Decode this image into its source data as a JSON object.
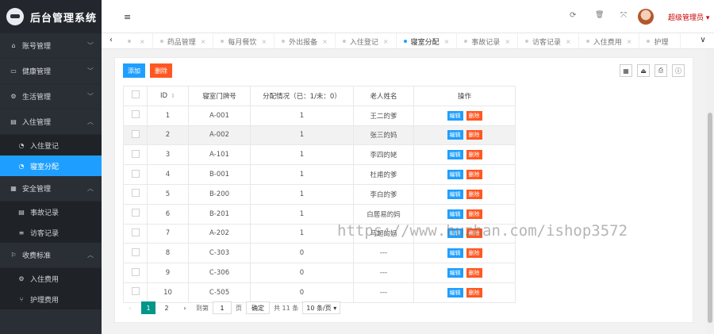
{
  "app": {
    "title": "后台管理系统"
  },
  "sidebar": {
    "items": [
      {
        "label": "账号管理",
        "icon": "home-icon",
        "glyph": "⌂",
        "caret": "﹀"
      },
      {
        "label": "健康管理",
        "icon": "monitor-icon",
        "glyph": "▭",
        "caret": "﹀"
      },
      {
        "label": "生活管理",
        "icon": "cogs-icon",
        "glyph": "⚙",
        "caret": "﹀"
      },
      {
        "label": "入住管理",
        "icon": "file-icon",
        "glyph": "▤",
        "caret": "︿",
        "children": [
          {
            "label": "入住登记",
            "icon": "dashboard-icon",
            "glyph": "◔"
          },
          {
            "label": "寝室分配",
            "icon": "dashboard-icon",
            "glyph": "◔",
            "active": true
          }
        ]
      },
      {
        "label": "安全管理",
        "icon": "calendar-icon",
        "glyph": "▦",
        "caret": "︿",
        "children": [
          {
            "label": "事故记录",
            "icon": "list-icon",
            "glyph": "▤"
          },
          {
            "label": "访客记录",
            "icon": "bars-icon",
            "glyph": "≡"
          }
        ]
      },
      {
        "label": "收费标准",
        "icon": "flag-icon",
        "glyph": "⚐",
        "caret": "︿",
        "children": [
          {
            "label": "入住费用",
            "icon": "gear-icon",
            "glyph": "⚙"
          },
          {
            "label": "护理费用",
            "icon": "fork-icon",
            "glyph": "⑂"
          }
        ]
      }
    ]
  },
  "topbar": {
    "menu_icon": "≡",
    "refresh_icon": "⟳",
    "trash_icon": "🗑",
    "fullscreen_icon": "⤧",
    "user": "超级管理员 ▾"
  },
  "tabs": {
    "prev": "‹",
    "next": "›",
    "more": "∨",
    "items": [
      {
        "label": "",
        "close": "×"
      },
      {
        "label": "药品管理",
        "close": "×"
      },
      {
        "label": "每月餐饮",
        "close": "×"
      },
      {
        "label": "外出报备",
        "close": "×"
      },
      {
        "label": "入住登记",
        "close": "×"
      },
      {
        "label": "寝室分配",
        "close": "×",
        "active": true
      },
      {
        "label": "事故记录",
        "close": "×"
      },
      {
        "label": "访客记录",
        "close": "×"
      },
      {
        "label": "入住费用",
        "close": "×"
      },
      {
        "label": "护理",
        "close": ""
      }
    ]
  },
  "toolbar": {
    "add_label": "添加",
    "delete_label": "删除"
  },
  "tools": [
    {
      "icon": "columns-icon",
      "glyph": "▦"
    },
    {
      "icon": "export-icon",
      "glyph": "⏏"
    },
    {
      "icon": "print-icon",
      "glyph": "⎙"
    },
    {
      "icon": "info-icon",
      "glyph": "ⓘ"
    }
  ],
  "table": {
    "headers": [
      "",
      "ID",
      "寝室门牌号",
      "分配情况（已：1/未：0）",
      "老人姓名",
      "操作"
    ],
    "sort_glyph": "⇕",
    "edit_label": "编辑",
    "delete_label": "删除",
    "rows": [
      {
        "id": "1",
        "room": "A-001",
        "assigned": "1",
        "name": "王二的爹"
      },
      {
        "id": "2",
        "room": "A-002",
        "assigned": "1",
        "name": "张三的妈",
        "highlight": true
      },
      {
        "id": "3",
        "room": "A-101",
        "assigned": "1",
        "name": "李四的姥"
      },
      {
        "id": "4",
        "room": "B-001",
        "assigned": "1",
        "name": "杜甫的爹"
      },
      {
        "id": "5",
        "room": "B-200",
        "assigned": "1",
        "name": "李白的爹"
      },
      {
        "id": "6",
        "room": "B-201",
        "assigned": "1",
        "name": "白居易的妈"
      },
      {
        "id": "7",
        "room": "A-202",
        "assigned": "1",
        "name": "马超的妈"
      },
      {
        "id": "8",
        "room": "C-303",
        "assigned": "0",
        "name": "---"
      },
      {
        "id": "9",
        "room": "C-306",
        "assigned": "0",
        "name": "---"
      },
      {
        "id": "10",
        "room": "C-505",
        "assigned": "0",
        "name": "---"
      }
    ]
  },
  "pager": {
    "prev": "‹",
    "current": "1",
    "page2": "2",
    "next": "›",
    "goto_label": "到第",
    "page_input": "1",
    "page_unit": "页",
    "confirm": "确定",
    "total": "共 11 条",
    "per_page": "10 条/页 ▾"
  },
  "watermark": "https://www.huzhan.com/ishop3572"
}
